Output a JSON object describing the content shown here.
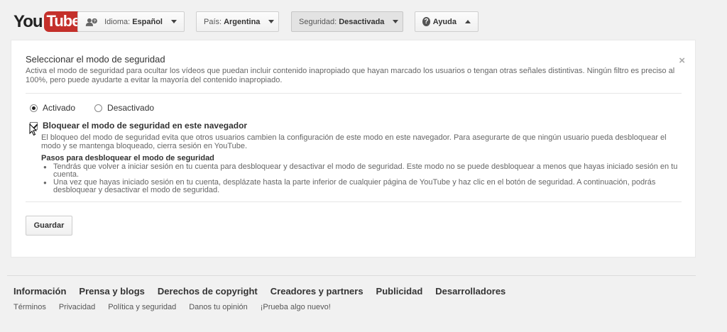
{
  "logo": {
    "you": "You",
    "tube": "Tube"
  },
  "header": {
    "language": {
      "label": "Idioma:",
      "value": "Español"
    },
    "country": {
      "label": "País:",
      "value": "Argentina"
    },
    "safety": {
      "label": "Seguridad:",
      "value": "Desactivada"
    },
    "help": {
      "label": "Ayuda"
    }
  },
  "panel": {
    "title": "Seleccionar el modo de seguridad",
    "description": "Activa el modo de seguridad para ocultar los vídeos que puedan incluir contenido inapropiado que hayan marcado los usuarios o tengan otras señales distintivas. Ningún filtro es preciso al 100%, pero puede ayudarte a evitar la mayoría del contenido inapropiado.",
    "close": "×",
    "radio_on": "Activado",
    "radio_off": "Desactivado",
    "lock_label": "Bloquear el modo de seguridad en este navegador",
    "lock_description": "El bloqueo del modo de seguridad evita que otros usuarios cambien la configuración de este modo en este navegador. Para asegurarte de que ningún usuario pueda desbloquear el modo y se mantenga bloqueado, cierra sesión en YouTube.",
    "steps_title": "Pasos para desbloquear el modo de seguridad",
    "steps": [
      "Tendrás que volver a iniciar sesión en tu cuenta para desbloquear y desactivar el modo de seguridad. Este modo no se puede desbloquear a menos que hayas iniciado sesión en tu cuenta.",
      "Una vez que hayas iniciado sesión en tu cuenta, desplázate hasta la parte inferior de cualquier página de YouTube y haz clic en el botón de seguridad. A continuación, podrás desbloquear y desactivar el modo de seguridad."
    ],
    "save": "Guardar"
  },
  "footer": {
    "main": [
      "Información",
      "Prensa y blogs",
      "Derechos de copyright",
      "Creadores y partners",
      "Publicidad",
      "Desarrolladores"
    ],
    "sub": [
      "Términos",
      "Privacidad",
      "Política y seguridad",
      "Danos tu opinión",
      "¡Prueba algo nuevo!"
    ]
  },
  "colors": {
    "brand": "#c4302b",
    "panel_bg": "#ffffff",
    "page_bg": "#f1f1f1"
  }
}
